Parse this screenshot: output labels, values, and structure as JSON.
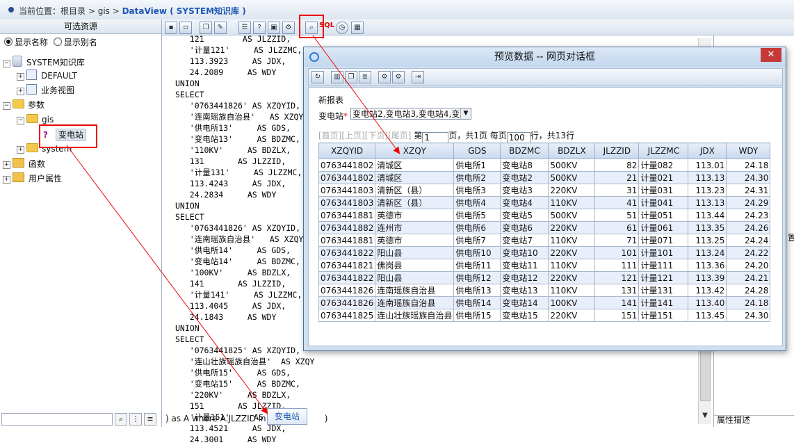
{
  "breadcrumb": {
    "prefix": "当前位置：",
    "root": "根目录 > gis > ",
    "current": "DataView ( SYSTEM知识库 )"
  },
  "left_panel": {
    "header": "可选资源",
    "radio_name": "显示名称",
    "radio_alias": "显示别名",
    "tree": {
      "root": "SYSTEM知识库",
      "default": "DEFAULT",
      "business_view": "业务视图",
      "params": "参数",
      "gis": "gis",
      "bdz": "变电站",
      "system": "system",
      "functions": "函数",
      "user_attrs": "用户属性"
    }
  },
  "editor": {
    "code": "   121        AS JLZZID,\n   '计量121'     AS JLZZMC,\n   113.3923     AS JDX,\n   24.2089     AS WDY\nUNION\nSELECT\n   '0763441826' AS XZQYID,\n   '连南瑶族自治县'   AS XZQY,\n   '供电所13'     AS GDS,\n   '变电站13'     AS BDZMC,\n   '110KV'     AS BDZLX,\n   131       AS JLZZID,\n   '计量131'     AS JLZZMC,\n   113.4243     AS JDX,\n   24.2834     AS WDY\nUNION\nSELECT\n   '0763441826' AS XZQYID,\n   '连南瑶族自治县'   AS XZQY,\n   '供电所14'     AS GDS,\n   '变电站14'     AS BDZMC,\n   '100KV'     AS BDZLX,\n   141       AS JLZZID,\n   '计量141'     AS JLZZMC,\n   113.4045     AS JDX,\n   24.1843     AS WDY\nUNION\nSELECT\n   '0763441825' AS XZQYID,\n   '连山壮族瑶族自治县'  AS XZQY\n   '供电所15'     AS GDS,\n   '变电站15'     AS BDZMC,\n   '220KV'     AS BDZLX,\n   151       AS JLZZID,\n   '计量151'     AS JLZZMC,\n   113.4521     AS JDX,\n   24.3001     AS WDY",
    "where_prefix": ") as A where A.JLZZID in (",
    "where_suffix": ")",
    "param_button": "变电站"
  },
  "toolbar": {
    "sql_label": "SQL"
  },
  "right_panel": {
    "cut_text": "置",
    "desc": "属性描述"
  },
  "dialog": {
    "title": "预览数据 -- 网页对话框",
    "report_name": "新报表",
    "select_label": "变电站",
    "select_required": "*",
    "select_value": "变电站2,变电站3,变电站4,变",
    "pager": {
      "first": "[首页]",
      "prev": "[上页]",
      "next": "[下页]",
      "last": "[尾页]",
      "page_prefix": "第",
      "page_value": "1",
      "page_suffix": "页，共1页 每页",
      "size_value": "100",
      "size_suffix": "行，共13行"
    },
    "columns": [
      "XZQYID",
      "XZQY",
      "GDS",
      "BDZMC",
      "BDZLX",
      "JLZZID",
      "JLZZMC",
      "JDX",
      "WDY"
    ],
    "rows": [
      [
        "0763441802",
        "清城区",
        "供电所1",
        "变电站8",
        "500KV",
        "82",
        "计量082",
        "113.01",
        "24.18"
      ],
      [
        "0763441802",
        "清城区",
        "供电所2",
        "变电站2",
        "500KV",
        "21",
        "计量021",
        "113.13",
        "24.30"
      ],
      [
        "0763441803",
        "清新区（县）",
        "供电所3",
        "变电站3",
        "220KV",
        "31",
        "计量031",
        "113.23",
        "24.31"
      ],
      [
        "0763441803",
        "清新区（县）",
        "供电所4",
        "变电站4",
        "110KV",
        "41",
        "计量041",
        "113.13",
        "24.29"
      ],
      [
        "0763441881",
        "英德市",
        "供电所5",
        "变电站5",
        "500KV",
        "51",
        "计量051",
        "113.44",
        "24.23"
      ],
      [
        "0763441882",
        "连州市",
        "供电所6",
        "变电站6",
        "220KV",
        "61",
        "计量061",
        "113.35",
        "24.26"
      ],
      [
        "0763441881",
        "英德市",
        "供电所7",
        "变电站7",
        "110KV",
        "71",
        "计量071",
        "113.25",
        "24.24"
      ],
      [
        "0763441822",
        "阳山县",
        "供电所10",
        "变电站10",
        "220KV",
        "101",
        "计量101",
        "113.24",
        "24.22"
      ],
      [
        "0763441821",
        "佛岗县",
        "供电所11",
        "变电站11",
        "110KV",
        "111",
        "计量111",
        "113.36",
        "24.20"
      ],
      [
        "0763441822",
        "阳山县",
        "供电所12",
        "变电站12",
        "220KV",
        "121",
        "计量121",
        "113.39",
        "24.21"
      ],
      [
        "0763441826",
        "连南瑶族自治县",
        "供电所13",
        "变电站13",
        "110KV",
        "131",
        "计量131",
        "113.42",
        "24.28"
      ],
      [
        "0763441826",
        "连南瑶族自治县",
        "供电所14",
        "变电站14",
        "100KV",
        "141",
        "计量141",
        "113.40",
        "24.18"
      ],
      [
        "0763441825",
        "连山壮族瑶族自治县",
        "供电所15",
        "变电站15",
        "220KV",
        "151",
        "计量151",
        "113.45",
        "24.30"
      ]
    ]
  }
}
